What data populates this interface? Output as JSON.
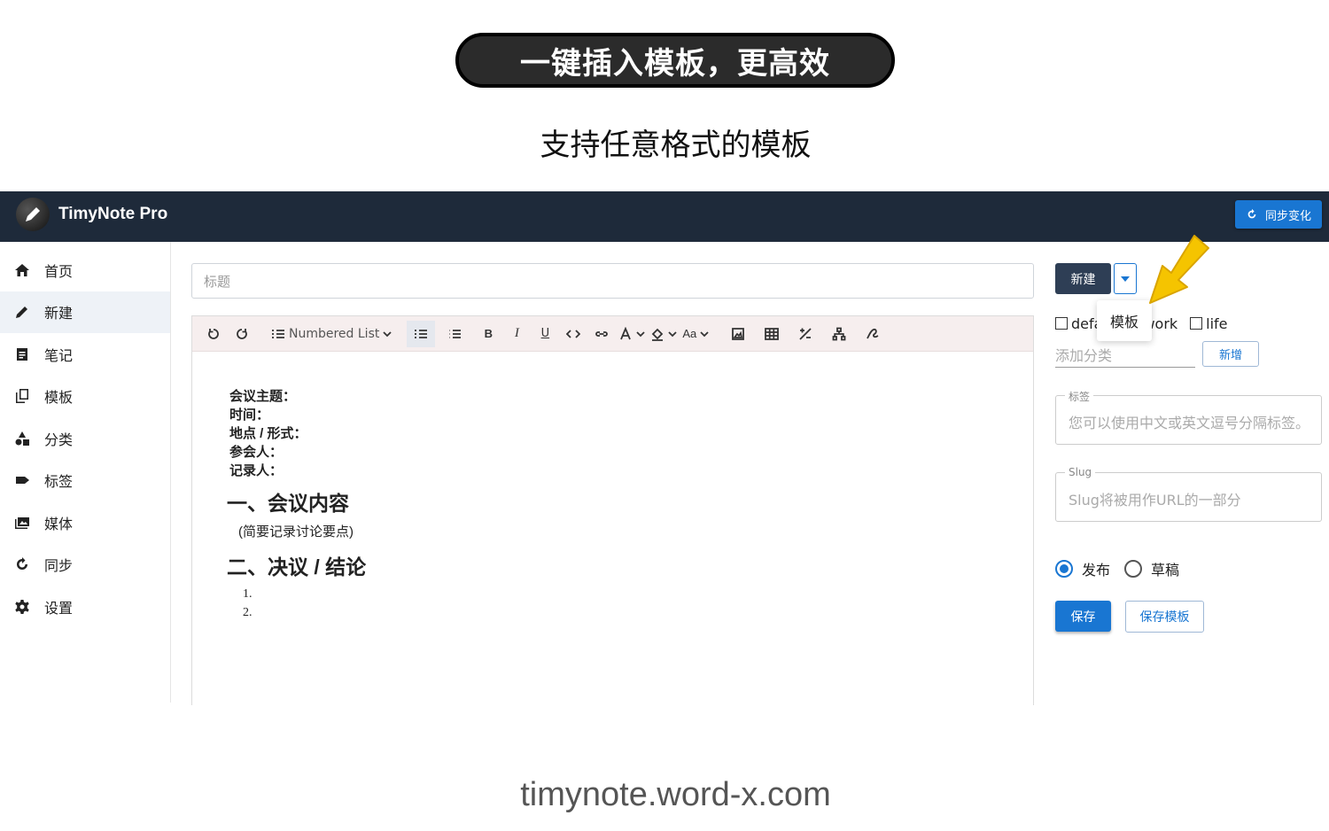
{
  "promo": {
    "headline": "一键插入模板，更高效",
    "subtitle": "支持任意格式的模板",
    "footer_url": "timynote.word-x.com"
  },
  "app": {
    "name": "TimyNote Pro",
    "sync_label": "同步变化"
  },
  "sidebar": {
    "items": [
      {
        "label": "首页",
        "icon": "home-icon"
      },
      {
        "label": "新建",
        "icon": "pencil-icon"
      },
      {
        "label": "笔记",
        "icon": "note-icon"
      },
      {
        "label": "模板",
        "icon": "copy-icon"
      },
      {
        "label": "分类",
        "icon": "shapes-icon"
      },
      {
        "label": "标签",
        "icon": "tag-icon"
      },
      {
        "label": "媒体",
        "icon": "images-icon"
      },
      {
        "label": "同步",
        "icon": "sync-icon"
      },
      {
        "label": "设置",
        "icon": "gear-icon"
      }
    ],
    "active_index": 1
  },
  "editor": {
    "title_placeholder": "标题",
    "block_type": "Numbered List",
    "font_size_label": "Aa",
    "content": {
      "meta_lines": [
        "会议主题：",
        "时间：",
        "地点 / 形式：",
        "参会人：",
        "记录人："
      ],
      "heading1": "一、会议内容",
      "note": "(简要记录讨论要点)",
      "heading2": "二、决议 / 结论",
      "list": [
        "1.",
        "2."
      ]
    }
  },
  "panel": {
    "new_label": "新建",
    "menu_item": "模板",
    "categories": [
      {
        "label": "defa",
        "checked": false
      },
      {
        "label": "work",
        "checked": false
      },
      {
        "label": "life",
        "checked": false
      }
    ],
    "add_category_placeholder": "添加分类",
    "add_label": "新增",
    "tags_legend": "标签",
    "tags_placeholder": "您可以使用中文或英文逗号分隔标签。",
    "slug_legend": "Slug",
    "slug_placeholder": "Slug将被用作URL的一部分",
    "status_options": [
      "发布",
      "草稿"
    ],
    "status_selected": "发布",
    "save_label": "保存",
    "save_template_label": "保存模板"
  },
  "colors": {
    "appbar": "#1e2a3a",
    "primary": "#1976d2",
    "toolbar_bg": "#f6eeee",
    "arrow": "#f5c400"
  }
}
